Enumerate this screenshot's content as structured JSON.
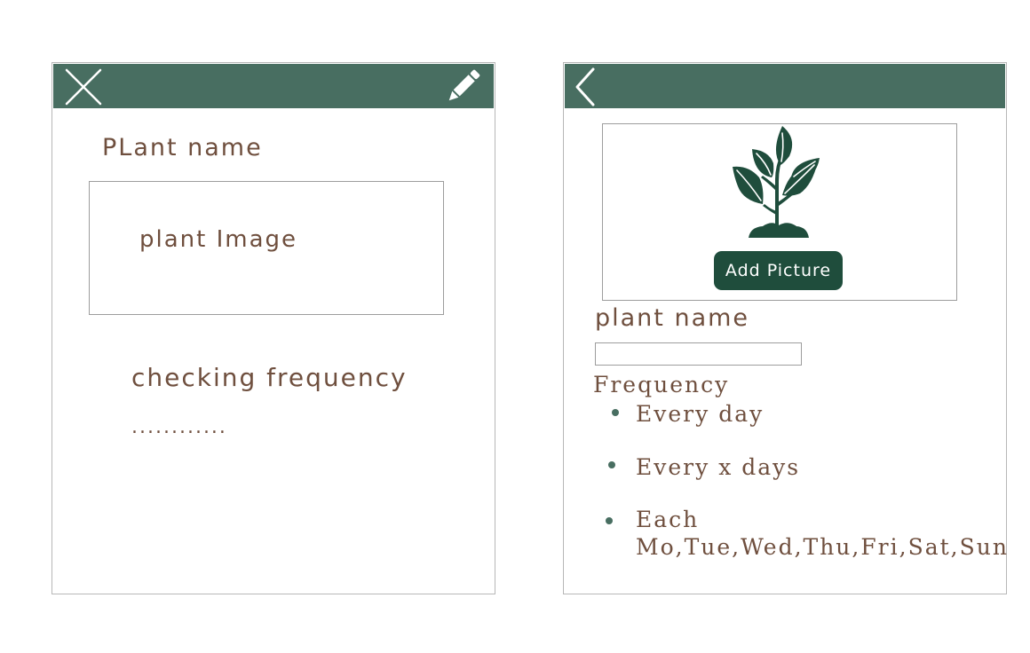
{
  "left_screen": {
    "title": "PLant name",
    "image_placeholder": "plant Image",
    "frequency_label": "checking frequency",
    "frequency_value": "............",
    "icons": {
      "close": "close-icon",
      "edit": "pencil-icon"
    }
  },
  "right_screen": {
    "add_picture_label": "Add Picture",
    "plant_name_label": "plant name",
    "plant_name_value": "",
    "frequency_label": "Frequency",
    "frequency_options": [
      {
        "line1": "Every day",
        "line2": ""
      },
      {
        "line1": "Every x days",
        "line2": ""
      },
      {
        "line1": "Each",
        "line2": "Mo,Tue,Wed,Thu,Fri,Sat,Sun"
      }
    ],
    "icons": {
      "back": "chevron-left-icon",
      "plant": "plant-sprout-icon"
    }
  },
  "colors": {
    "header_green": "#486e61",
    "button_green": "#1f4d3c",
    "text_brown": "#6f4f3e",
    "border_gray": "#9d9d9d"
  }
}
